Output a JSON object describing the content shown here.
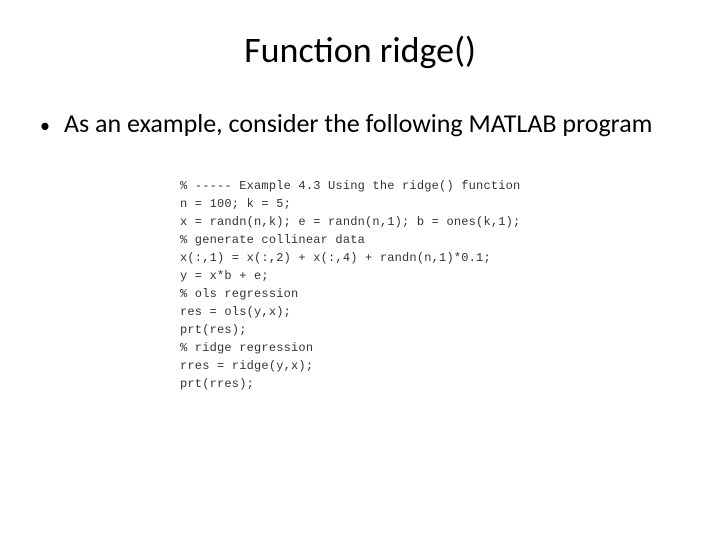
{
  "title": "Function ridge()",
  "bullet": "As an example, consider the following MATLAB program",
  "code": "% ----- Example 4.3 Using the ridge() function\nn = 100; k = 5;\nx = randn(n,k); e = randn(n,1); b = ones(k,1);\n% generate collinear data\nx(:,1) = x(:,2) + x(:,4) + randn(n,1)*0.1;\ny = x*b + e;\n% ols regression\nres = ols(y,x);\nprt(res);\n% ridge regression\nrres = ridge(y,x);\nprt(rres);"
}
